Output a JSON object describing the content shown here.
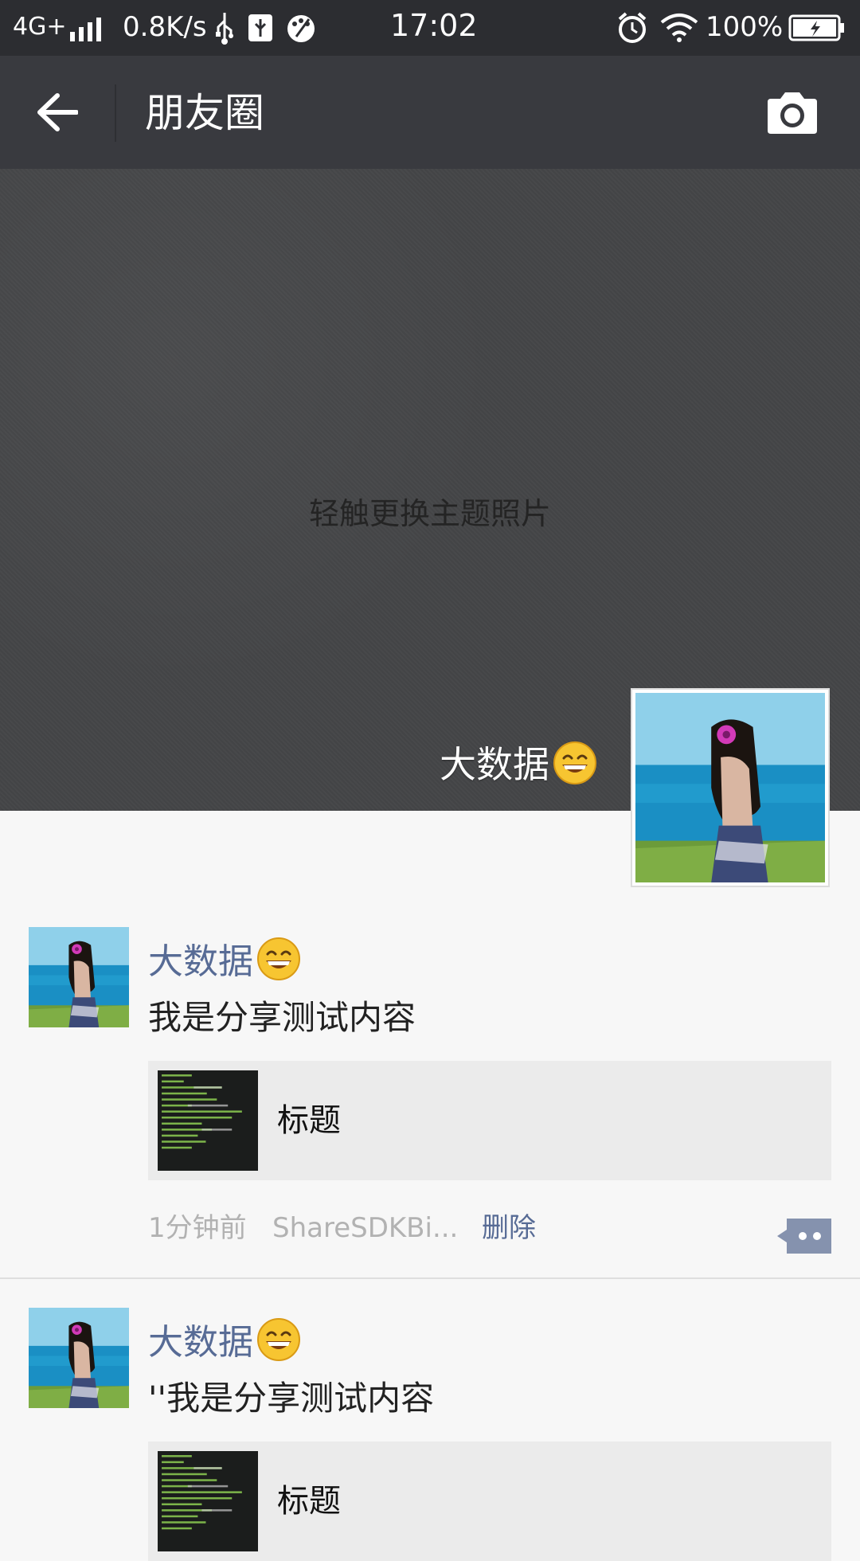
{
  "status_bar": {
    "network": "4G+",
    "speed": "0.8K/s",
    "time": "17:02",
    "battery": "100%"
  },
  "nav": {
    "title": "朋友圈"
  },
  "cover": {
    "hint": "轻触更换主题照片",
    "user_name": "大数据"
  },
  "posts": [
    {
      "name": "大数据",
      "text": "我是分享测试内容",
      "card_title": "标题",
      "time": "1分钟前",
      "source": "ShareSDKBi...",
      "delete_label": "删除"
    },
    {
      "name": "大数据",
      "text": "''我是分享测试内容",
      "card_title": "标题"
    }
  ],
  "colors": {
    "status_bg": "#2c2d31",
    "nav_bg": "#393a3f",
    "link_blue": "#576b95"
  }
}
